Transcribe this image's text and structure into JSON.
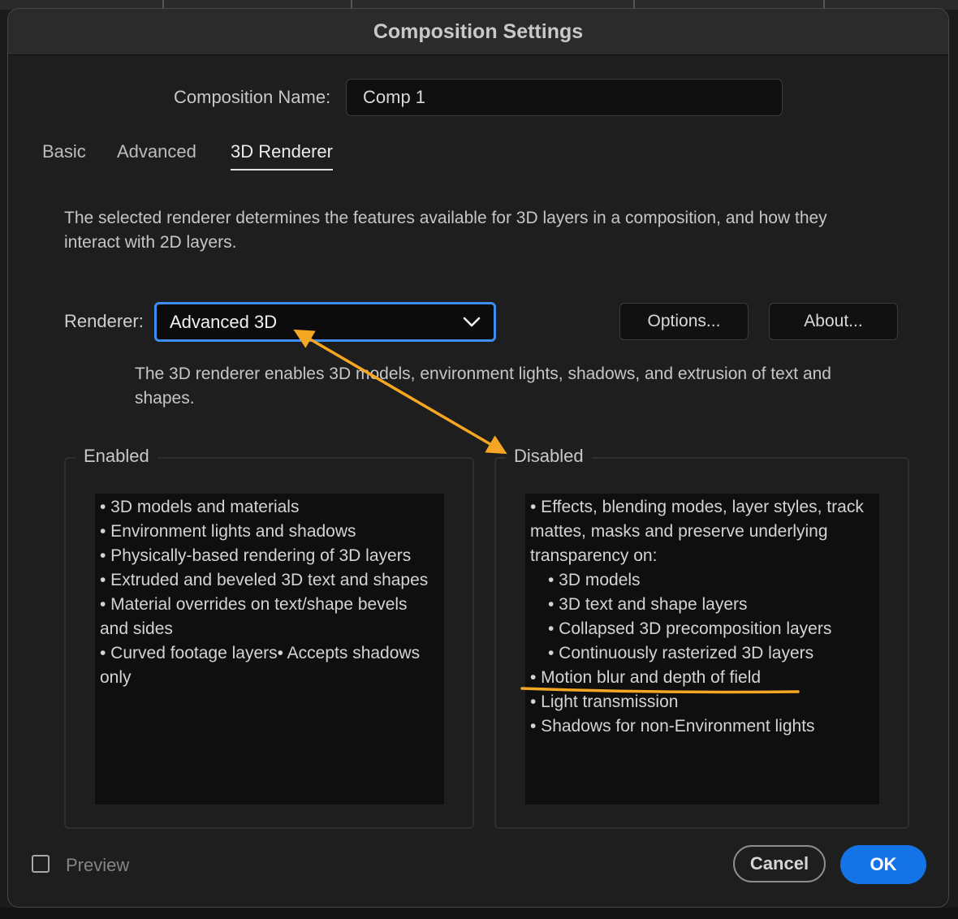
{
  "dialog": {
    "title": "Composition Settings",
    "name_label": "Composition Name:",
    "name_value": "Comp 1"
  },
  "tabs": [
    {
      "label": "Basic",
      "active": false
    },
    {
      "label": "Advanced",
      "active": false
    },
    {
      "label": "3D Renderer",
      "active": true
    }
  ],
  "description": "The selected renderer determines the features available for 3D layers in a composition, and how they interact with 2D layers.",
  "renderer": {
    "label": "Renderer:",
    "selected": "Advanced 3D",
    "options_button": "Options...",
    "about_button": "About...",
    "description": "The 3D renderer enables 3D models, environment lights, shadows, and extrusion of text and shapes."
  },
  "enabled": {
    "title": "Enabled",
    "items": [
      "• 3D models and materials",
      "• Environment lights and shadows",
      "• Physically-based rendering of 3D layers",
      "• Extruded and beveled 3D text and shapes",
      "• Material overrides on text/shape bevels and sides",
      "• Curved footage layers• Accepts shadows only"
    ]
  },
  "disabled": {
    "title": "Disabled",
    "items": [
      "• Effects, blending modes, layer styles, track mattes, masks and preserve underlying transparency on:",
      "• 3D models",
      "• 3D text and shape layers",
      "• Collapsed 3D precomposition layers",
      "• Continuously rasterized 3D layers",
      "• Motion blur and depth of field",
      "• Light transmission",
      "• Shadows for non-Environment lights"
    ]
  },
  "footer": {
    "preview_label": "Preview",
    "preview_checked": false,
    "cancel_label": "Cancel",
    "ok_label": "OK"
  },
  "colors": {
    "accent": "#1473e6",
    "focus_ring": "#3d8ef0",
    "annotation": "#f5a623"
  },
  "icons": {
    "dropdown": "chevron-down-icon"
  }
}
